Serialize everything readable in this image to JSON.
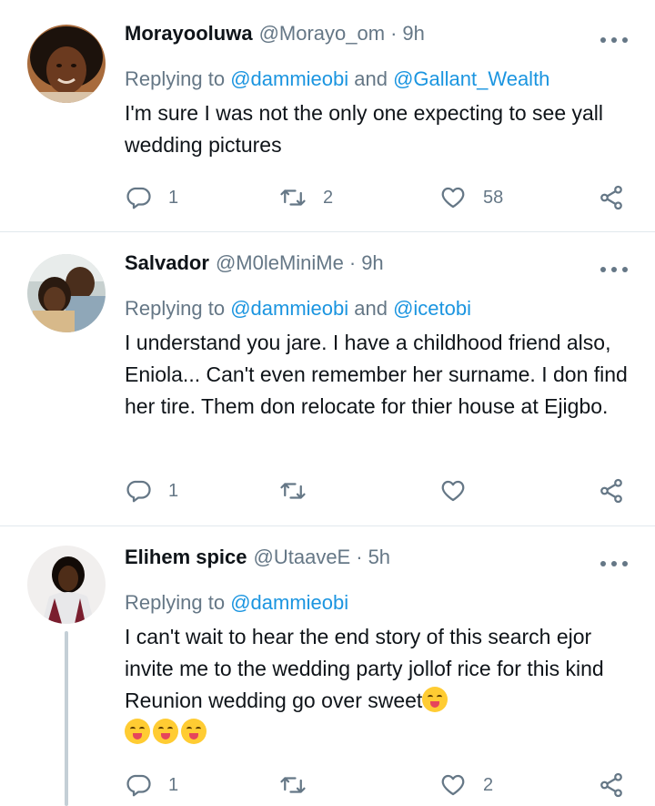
{
  "tweets": [
    {
      "name": "Morayooluwa",
      "handle": "@Morayo_om",
      "dot": "·",
      "time": "9h",
      "replying_prefix": "Replying to ",
      "mention_1": "@dammieobi",
      "and_word": " and ",
      "mention_2": "@Gallant_Wealth",
      "text": "I'm sure I was not the only one expecting to see yall wedding pictures",
      "replies": "1",
      "retweets": "2",
      "likes": "58"
    },
    {
      "name": "Salvador",
      "handle": "@M0leMiniMe",
      "dot": "·",
      "time": "9h",
      "replying_prefix": "Replying to ",
      "mention_1": "@dammieobi",
      "and_word": " and ",
      "mention_2": "@icetobi",
      "text": "I understand you jare. I have a childhood friend also, Eniola... Can't even remember her surname. I don find her tire. Them don relocate for thier house at Ejigbo.",
      "replies": "1",
      "retweets": "",
      "likes": ""
    },
    {
      "name": "Elihem spice",
      "handle": "@UtaaveE",
      "dot": "·",
      "time": "5h",
      "replying_prefix": "Replying to ",
      "mention_1": "@dammieobi",
      "text": "I can't wait to hear the end story of this search ejor invite me to the wedding party jollof rice for this kind Reunion wedding go over sweet",
      "emoji_name": "face-savoring-food",
      "replies": "1",
      "retweets": "",
      "likes": "2"
    }
  ],
  "colors": {
    "link": "#1b95e0",
    "muted": "#657786",
    "text": "#0f1419",
    "divider": "#e1e8ed"
  },
  "icons": {
    "reply": "reply-icon",
    "retweet": "retweet-icon",
    "like": "heart-icon",
    "share": "share-icon",
    "more": "more-options-icon"
  }
}
